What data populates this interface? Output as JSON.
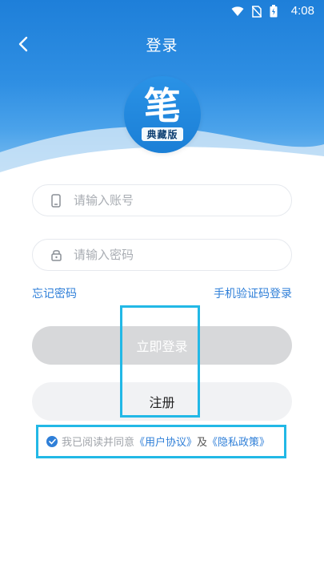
{
  "status_bar": {
    "time": "4:08",
    "icons": [
      "wifi-icon",
      "no-sim-icon",
      "battery-icon"
    ]
  },
  "nav": {
    "title": "登录",
    "back_icon": "chevron-left-icon"
  },
  "logo": {
    "main": "笔",
    "sub": "典藏版"
  },
  "form": {
    "account_placeholder": "请输入账号",
    "account_value": "",
    "password_placeholder": "请输入密码",
    "password_value": "",
    "account_icon": "phone-icon",
    "password_icon": "lock-icon"
  },
  "links": {
    "forgot": "忘记密码",
    "sms_login": "手机验证码登录"
  },
  "buttons": {
    "login": "立即登录",
    "register": "注册"
  },
  "agreement": {
    "prefix": "我已阅读并同意",
    "user_agreement": "《用户协议》",
    "and": "及",
    "privacy_policy": "《隐私政策》",
    "checked": true
  },
  "colors": {
    "primary": "#2f7fd8",
    "highlight": "#22b8e6",
    "header": "#1e7fd9"
  }
}
